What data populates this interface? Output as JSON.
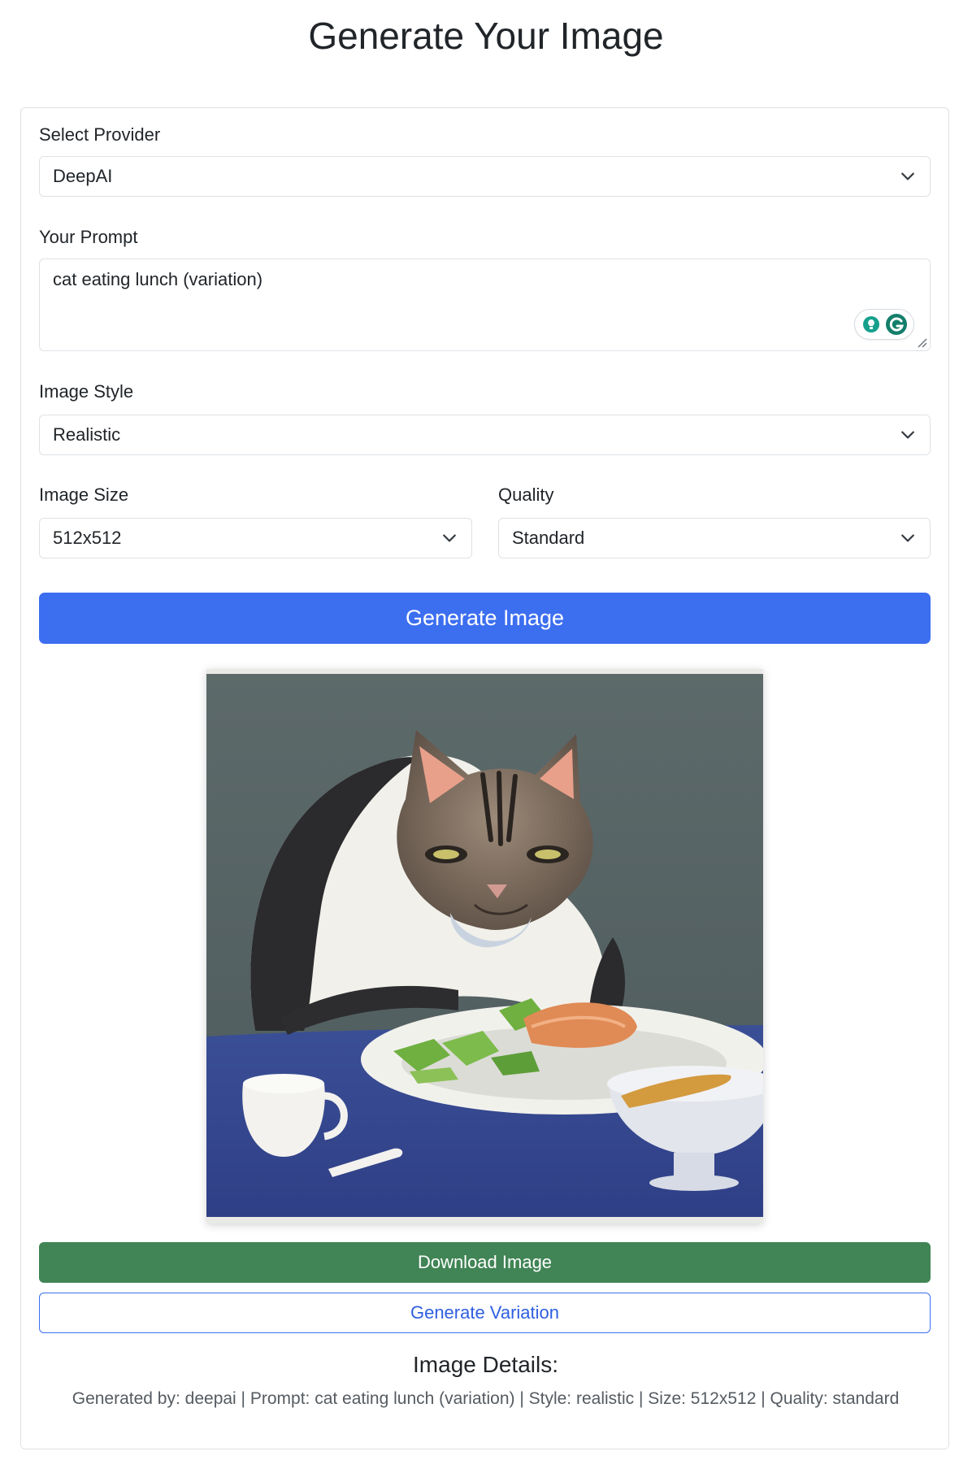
{
  "page": {
    "title": "Generate Your Image"
  },
  "form": {
    "provider": {
      "label": "Select Provider",
      "value": "DeepAI"
    },
    "prompt": {
      "label": "Your Prompt",
      "value": "cat eating lunch (variation)"
    },
    "style": {
      "label": "Image Style",
      "value": "Realistic"
    },
    "size": {
      "label": "Image Size",
      "value": "512x512"
    },
    "quality": {
      "label": "Quality",
      "value": "Standard"
    },
    "generate_label": "Generate Image"
  },
  "result": {
    "image_icon": "generated-image",
    "download_label": "Download Image",
    "variation_label": "Generate Variation",
    "details_title": "Image Details:",
    "details_text": "Generated by: deepai | Prompt: cat eating lunch (variation) | Style: realistic | Size: 512x512 | Quality: standard"
  },
  "colors": {
    "primary": "#3c6ef0",
    "success": "#418455",
    "border": "#dee2e6"
  }
}
